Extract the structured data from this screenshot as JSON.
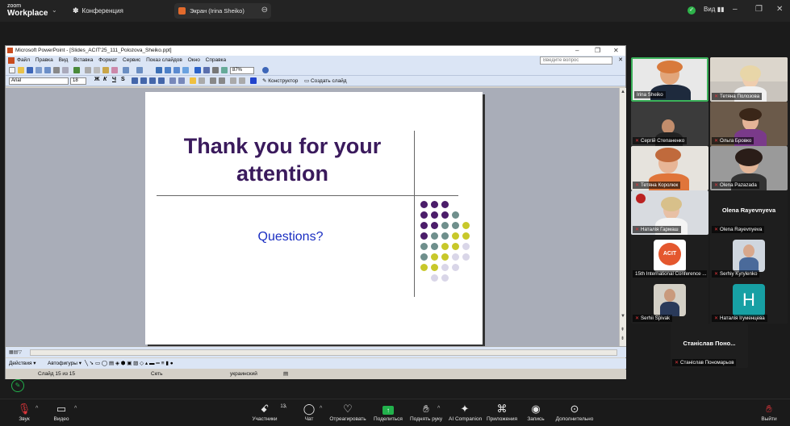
{
  "zoom": {
    "logo_small": "zoom",
    "logo_big": "Workplace",
    "meeting_label": "Конференция",
    "share_tab": "Экран (Irina Sheiko)",
    "view_label": "Вид",
    "colors": {
      "bar": "#232323",
      "accent": "#22b14c",
      "share_icon": "#e26a2c"
    }
  },
  "ppt": {
    "window_title": "Microsoft PowerPoint - [Slides_ACIT'25_111_Polozova_Sheiko.ppt]",
    "menu": [
      "Файл",
      "Правка",
      "Вид",
      "Вставка",
      "Формат",
      "Сервис",
      "Показ слайдов",
      "Окно",
      "Справка"
    ],
    "ask_placeholder": "Введите вопрос",
    "font": "Arial",
    "size": "18",
    "zoom": "87%",
    "format_b": "Ж",
    "format_i": "К",
    "format_u": "Ч",
    "format_s": "S",
    "designer": "Конструктор",
    "new_slide": "Создать слайд",
    "draw_actions": "Действия ▾",
    "draw_autoshapes": "Автофигуры ▾",
    "status_slide": "Слайд 15 из 15",
    "status_design": "Сеть",
    "status_lang": "украинский",
    "slide": {
      "title": "Thank you for your attention",
      "subtitle": "Questions?",
      "colors": {
        "title": "#3a1a5c",
        "subtitle": "#1a2ec2"
      }
    }
  },
  "participants": [
    {
      "name": "Irina Sheiko",
      "muted": false,
      "active": true
    },
    {
      "name": "Тетяна Полозова",
      "muted": true
    },
    {
      "name": "Сергій Степаненко",
      "muted": true
    },
    {
      "name": "Ольга Бровко",
      "muted": true
    },
    {
      "name": "Тетяна Королюк",
      "muted": true
    },
    {
      "name": "Olena Pazazada",
      "muted": true
    },
    {
      "name": "Наталія Гармаш",
      "muted": true
    },
    {
      "name": "Olena Rayevnyeva",
      "muted": true,
      "display": "Olena Rayevnyeva"
    },
    {
      "name": "15th International Conference ...",
      "muted": false,
      "logo_text": "ACIT"
    },
    {
      "name": "Serhiy Kyrylenko",
      "muted": true
    },
    {
      "name": "Serhii Spivak",
      "muted": true
    },
    {
      "name": "Наталія Ігуменцева",
      "muted": true,
      "initial": "H"
    },
    {
      "name": "Станіслав Пономарьов",
      "muted": true,
      "display": "Станіслав Поно..."
    }
  ],
  "controls": {
    "audio": "Звук",
    "video": "Видео",
    "participants": "Участники",
    "participants_count": "13",
    "chat": "Чат",
    "react": "Отреагировать",
    "share": "Поделиться",
    "raise": "Поднять руку",
    "ai": "AI Companion",
    "apps": "Приложения",
    "record": "Запись",
    "more": "Дополнительно",
    "leave": "Выйти"
  }
}
